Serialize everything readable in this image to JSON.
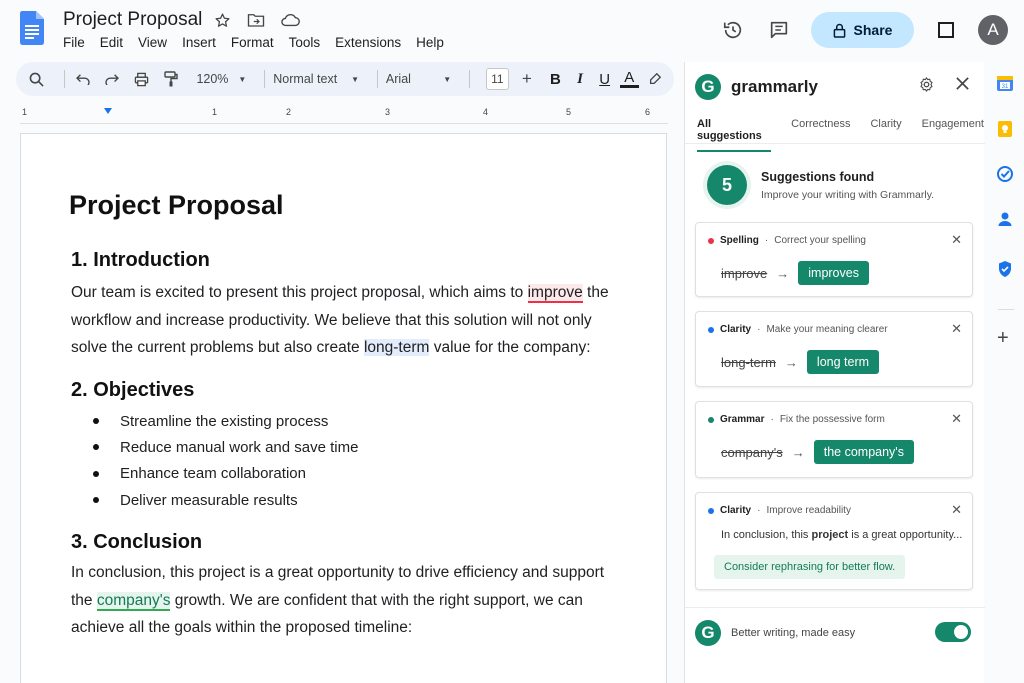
{
  "app": {
    "title": "Project Proposal",
    "menu": [
      "File",
      "Edit",
      "View",
      "Insert",
      "Format",
      "Tools",
      "Extensions",
      "Help"
    ],
    "share_label": "Share",
    "avatar_letter": "A"
  },
  "toolbar": {
    "zoom": "120%",
    "style": "Normal text",
    "font": "Arial",
    "font_size": "11",
    "bold": "B",
    "italic": "I",
    "underline": "U",
    "text_color": "A"
  },
  "ruler": {
    "numbers": [
      "1",
      "1",
      "2",
      "3",
      "4",
      "5",
      "6"
    ]
  },
  "document": {
    "title": "Project Proposal",
    "intro_heading": "1. Introduction",
    "intro_l1_a": "Our team is excited to present this project proposal, which aims to ",
    "intro_l1_flag": "improve",
    "intro_l1_b": " the",
    "intro_l2": "workflow and increase productivity. We believe that this solution will not only",
    "intro_l3_a": "solve the current problems but also create ",
    "intro_l3_flag": "long-term",
    "intro_l3_b": " value for the company:",
    "objectives_heading": "2. Objectives",
    "objectives": [
      "Streamline the existing process",
      "Reduce manual work and save time",
      "Enhance team collaboration",
      "Deliver measurable results"
    ],
    "conclusion_heading": "3. Conclusion",
    "concl_l1": "In conclusion, this project is a great opportunity to drive efficiency and support",
    "concl_l2_a": "the ",
    "concl_l2_flag": "company's",
    "concl_l2_b": " growth. We are confident that with the right support, we can",
    "concl_l3": "achieve all the goals within the proposed timeline:"
  },
  "grammarly": {
    "name": "grammarly",
    "tabs": [
      "All suggestions",
      "Correctness",
      "Clarity",
      "Engagement"
    ],
    "count": "5",
    "summary_title": "Suggestions found",
    "summary_sub": "Improve your writing with Grammarly.",
    "cards": [
      {
        "category": "Spelling",
        "desc": "Correct your spelling",
        "old": "improve",
        "new": "improves",
        "color": "#e8334a"
      },
      {
        "category": "Clarity",
        "desc": "Make your meaning clearer",
        "old": "long-term",
        "new": "long term",
        "color": "#1a73e8"
      },
      {
        "category": "Grammar",
        "desc": "Fix the possessive form",
        "old": "company's",
        "new": "the company's",
        "color": "#15876a"
      },
      {
        "category": "Clarity",
        "desc": "Improve readability",
        "text_a": "In conclusion, this ",
        "text_bold": "project",
        "text_b": " is a great opportunity...",
        "hint": "Consider rephrasing for better flow.",
        "color": "#1a73e8"
      }
    ],
    "footer_text": "Better writing, made easy",
    "footer_logo": "G",
    "enabled": true
  },
  "colors": {
    "accent": "#15876a",
    "share_bg": "#c2e7ff",
    "docs_blue": "#4285f4"
  }
}
